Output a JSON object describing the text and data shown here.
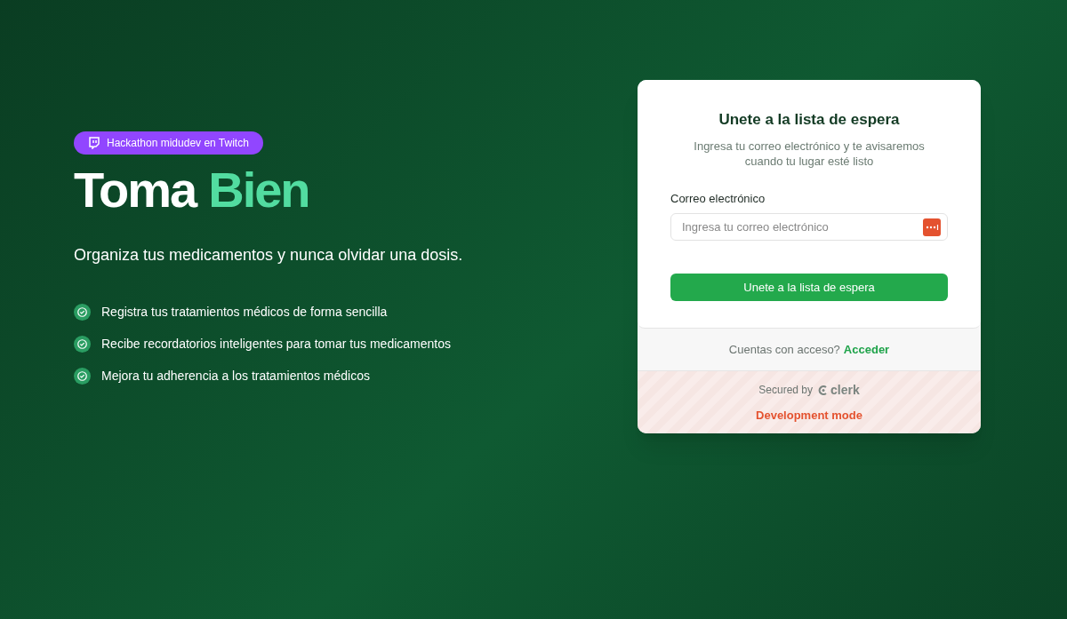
{
  "badge": {
    "label": "Hackathon midudev en Twitch"
  },
  "hero": {
    "title_main": "Toma",
    "title_accent": "Bien",
    "subtitle": "Organiza tus medicamentos y nunca olvidar una dosis."
  },
  "features": [
    {
      "text": "Registra tus tratamientos médicos de forma sencilla"
    },
    {
      "text": "Recibe recordatorios inteligentes para tomar tus medicamentos"
    },
    {
      "text": "Mejora tu adherencia a los tratamientos médicos"
    }
  ],
  "card": {
    "title": "Unete a la lista de espera",
    "description": "Ingresa tu correo electrónico y te avisaremos cuando tu lugar esté listo",
    "email_label": "Correo electrónico",
    "email_placeholder": "Ingresa tu correo electrónico",
    "submit": "Unete a la lista de espera",
    "footer_prompt": "Cuentas con acceso?",
    "footer_link": "Acceder",
    "secured_by": "Secured by",
    "brand": "clerk",
    "dev_mode": "Development mode"
  }
}
